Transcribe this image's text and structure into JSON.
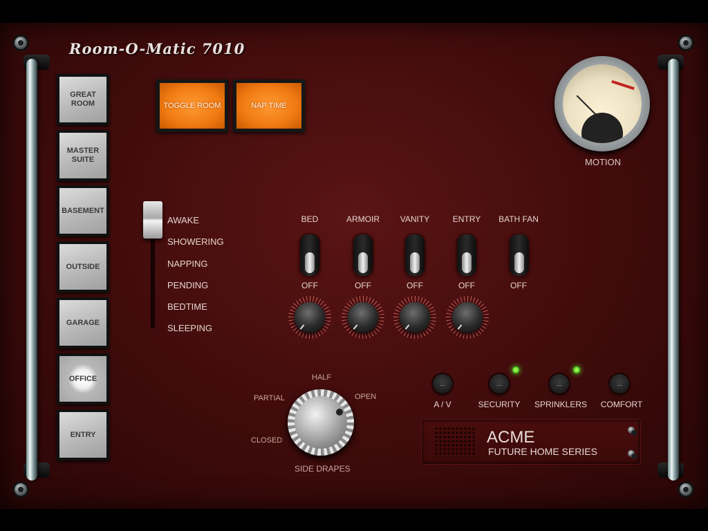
{
  "app": {
    "title": "Room-O-Matic 7010"
  },
  "rooms": [
    {
      "label": "GREAT\nROOM",
      "active": false
    },
    {
      "label": "MASTER\nSUITE",
      "active": false
    },
    {
      "label": "BASEMENT",
      "active": false
    },
    {
      "label": "OUTSIDE",
      "active": false
    },
    {
      "label": "GARAGE",
      "active": false
    },
    {
      "label": "OFFICE",
      "active": true
    },
    {
      "label": "ENTRY",
      "active": false
    }
  ],
  "actions": {
    "toggle_room": "TOGGLE ROOM",
    "nap_time": "NAP TIME"
  },
  "modes": [
    "AWAKE",
    "SHOWERING",
    "NAPPING",
    "PENDING",
    "BEDTIME",
    "SLEEPING"
  ],
  "switches": [
    {
      "name": "BED",
      "state": "OFF"
    },
    {
      "name": "ARMOIR",
      "state": "OFF"
    },
    {
      "name": "VANITY",
      "state": "OFF"
    },
    {
      "name": "ENTRY",
      "state": "OFF"
    },
    {
      "name": "BATH FAN",
      "state": "OFF"
    }
  ],
  "meter": {
    "label": "MOTION"
  },
  "drapes": {
    "label": "SIDE DRAPES",
    "positions": {
      "closed": "CLOSED",
      "partial": "PARTIAL",
      "half": "HALF",
      "open": "OPEN"
    }
  },
  "systems": [
    {
      "label": "A / V",
      "led": false,
      "glyph": "..."
    },
    {
      "label": "SECURITY",
      "led": true,
      "glyph": "..."
    },
    {
      "label": "SPRINKLERS",
      "led": true,
      "glyph": "..."
    },
    {
      "label": "COMFORT",
      "led": false,
      "glyph": "..."
    }
  ],
  "brand": {
    "name": "ACME",
    "series": "FUTURE HOME SERIES"
  },
  "colors": {
    "panel": "#4a0e0e",
    "accent": "#f07a12",
    "led": "#4fd122"
  }
}
